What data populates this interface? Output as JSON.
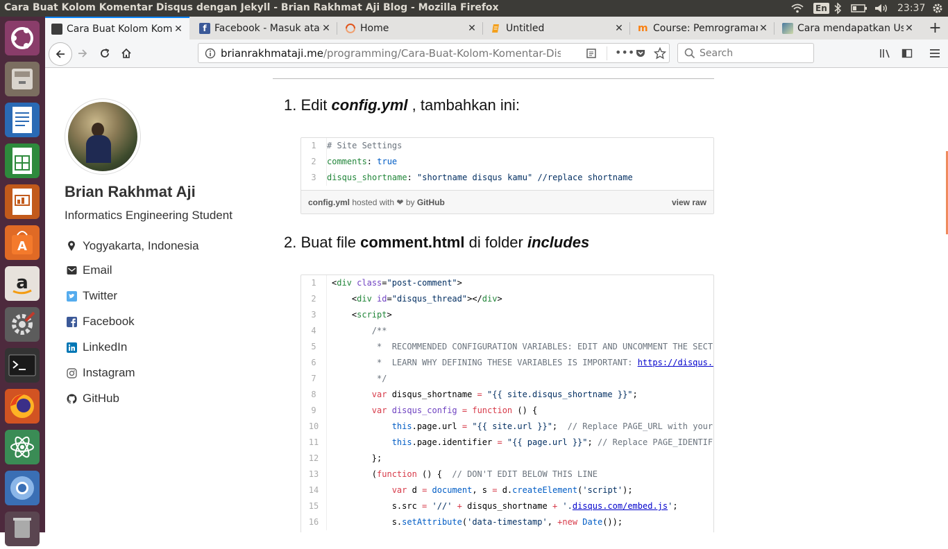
{
  "system": {
    "window_title": "Cara Buat Kolom Komentar Disqus dengan Jekyll - Brian Rakhmat Aji Blog - Mozilla Firefox",
    "keyboard_layout": "En",
    "time": "23:37"
  },
  "launcher": {
    "items": [
      "ubuntu-dash",
      "files",
      "libreoffice-writer",
      "libreoffice-calc",
      "libreoffice-impress",
      "ubuntu-software",
      "amazon",
      "system-settings",
      "terminal",
      "firefox",
      "atom",
      "chromium",
      "trash"
    ]
  },
  "tabs": [
    {
      "label": "Cara Buat Kolom Kome",
      "active": true
    },
    {
      "label": "Facebook - Masuk atau",
      "active": false
    },
    {
      "label": "Home",
      "active": false
    },
    {
      "label": "Untitled",
      "active": false
    },
    {
      "label": "Course: Pemrograman",
      "active": false
    },
    {
      "label": "Cara mendapatkan Us",
      "active": false
    }
  ],
  "navbar": {
    "url_host": "brianrakhmataji.me",
    "url_path": "/programming/Cara-Buat-Kolom-Komentar-Disqus-d",
    "search_placeholder": "Search"
  },
  "profile": {
    "name": "Brian Rakhmat Aji",
    "role": "Informatics Engineering Student",
    "links": [
      {
        "label": "Yogyakarta, Indonesia",
        "icon": "map-marker-icon"
      },
      {
        "label": "Email",
        "icon": "envelope-icon"
      },
      {
        "label": "Twitter",
        "icon": "twitter-icon"
      },
      {
        "label": "Facebook",
        "icon": "facebook-icon"
      },
      {
        "label": "LinkedIn",
        "icon": "linkedin-icon"
      },
      {
        "label": "Instagram",
        "icon": "instagram-icon"
      },
      {
        "label": "GitHub",
        "icon": "github-icon"
      }
    ]
  },
  "article": {
    "step1": {
      "num": "1.",
      "pre": "Edit",
      "file": "config.yml",
      "post": ", tambahkan ini:"
    },
    "step2": {
      "num": "2.",
      "pre": "Buat file",
      "file": "comment.html",
      "mid": "di folder",
      "folder": "includes"
    },
    "gist1": {
      "lines": [
        "1",
        "2",
        "3"
      ],
      "filename": "config.yml",
      "hosted": "hosted with",
      "heart": "❤",
      "by": "by",
      "github": "GitHub",
      "view_raw": "view raw"
    },
    "gist2": {
      "lines": [
        "1",
        "2",
        "3",
        "4",
        "5",
        "6",
        "7",
        "8",
        "9",
        "10",
        "11",
        "12",
        "13",
        "14",
        "15",
        "16"
      ]
    }
  },
  "colors": {
    "accent": "#0a84ff",
    "launcher_bg": "#4d2a3d",
    "topbar_bg": "#3c3b37"
  }
}
